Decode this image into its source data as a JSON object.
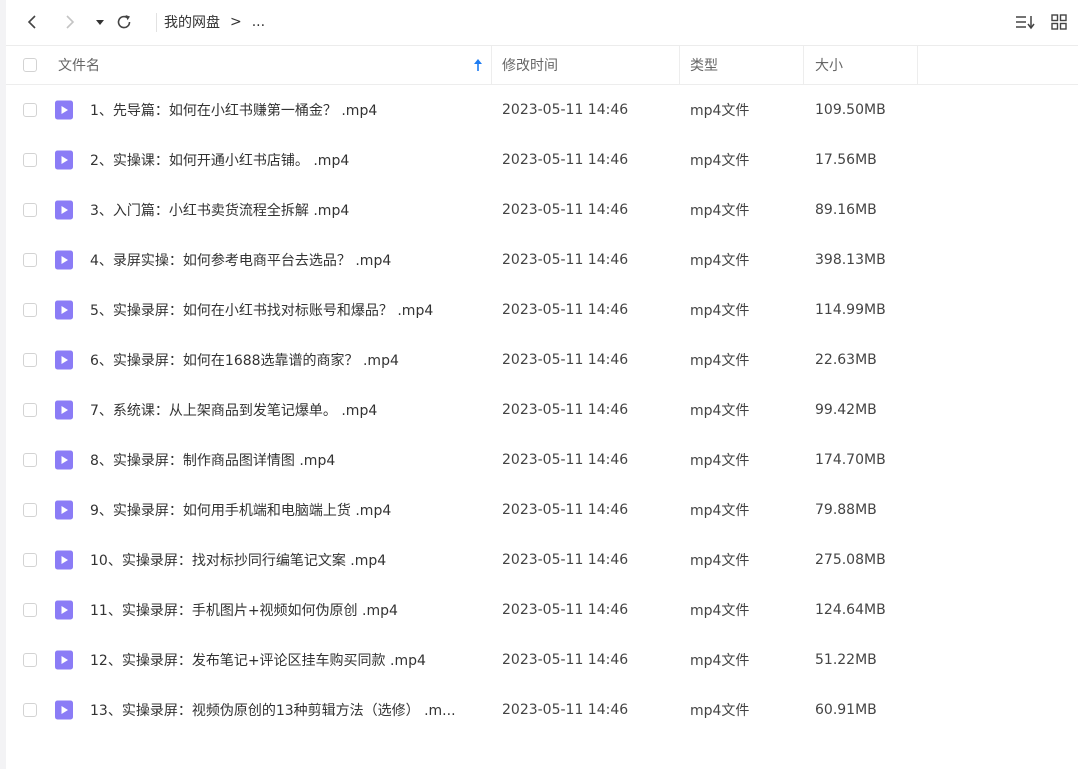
{
  "toolbar": {
    "back_icon": "chevron-left-icon",
    "forward_icon": "chevron-right-icon",
    "dropdown_icon": "caret-down-icon",
    "refresh_icon": "refresh-icon",
    "breadcrumb": [
      "我的网盘",
      ">",
      "..."
    ],
    "sort_icon": "sort-list-icon",
    "grid_icon": "grid-view-icon"
  },
  "columns": {
    "name": "文件名",
    "modified": "修改时间",
    "type": "类型",
    "size": "大小"
  },
  "sort_arrow_color": "#1e7cf2",
  "file_icon_color": "#8b7cf6",
  "files": [
    {
      "name": "1、先导篇：如何在小红书赚第一桶金？ .mp4",
      "modified": "2023-05-11 14:46",
      "type": "mp4文件",
      "size": "109.50MB"
    },
    {
      "name": "2、实操课：如何开通小红书店铺。 .mp4",
      "modified": "2023-05-11 14:46",
      "type": "mp4文件",
      "size": "17.56MB"
    },
    {
      "name": "3、入门篇：小红书卖货流程全拆解 .mp4",
      "modified": "2023-05-11 14:46",
      "type": "mp4文件",
      "size": "89.16MB"
    },
    {
      "name": "4、录屏实操：如何参考电商平台去选品？ .mp4",
      "modified": "2023-05-11 14:46",
      "type": "mp4文件",
      "size": "398.13MB"
    },
    {
      "name": "5、实操录屏：如何在小红书找对标账号和爆品？ .mp4",
      "modified": "2023-05-11 14:46",
      "type": "mp4文件",
      "size": "114.99MB"
    },
    {
      "name": "6、实操录屏：如何在1688选靠谱的商家？ .mp4",
      "modified": "2023-05-11 14:46",
      "type": "mp4文件",
      "size": "22.63MB"
    },
    {
      "name": "7、系统课：从上架商品到发笔记爆单。 .mp4",
      "modified": "2023-05-11 14:46",
      "type": "mp4文件",
      "size": "99.42MB"
    },
    {
      "name": "8、实操录屏：制作商品图详情图 .mp4",
      "modified": "2023-05-11 14:46",
      "type": "mp4文件",
      "size": "174.70MB"
    },
    {
      "name": "9、实操录屏：如何用手机端和电脑端上货 .mp4",
      "modified": "2023-05-11 14:46",
      "type": "mp4文件",
      "size": "79.88MB"
    },
    {
      "name": "10、实操录屏：找对标抄同行编笔记文案 .mp4",
      "modified": "2023-05-11 14:46",
      "type": "mp4文件",
      "size": "275.08MB"
    },
    {
      "name": "11、实操录屏：手机图片+视频如何伪原创 .mp4",
      "modified": "2023-05-11 14:46",
      "type": "mp4文件",
      "size": "124.64MB"
    },
    {
      "name": "12、实操录屏：发布笔记+评论区挂车购买同款 .mp4",
      "modified": "2023-05-11 14:46",
      "type": "mp4文件",
      "size": "51.22MB"
    },
    {
      "name": "13、实操录屏：视频伪原创的13种剪辑方法（选修） .m...",
      "modified": "2023-05-11 14:46",
      "type": "mp4文件",
      "size": "60.91MB"
    }
  ]
}
